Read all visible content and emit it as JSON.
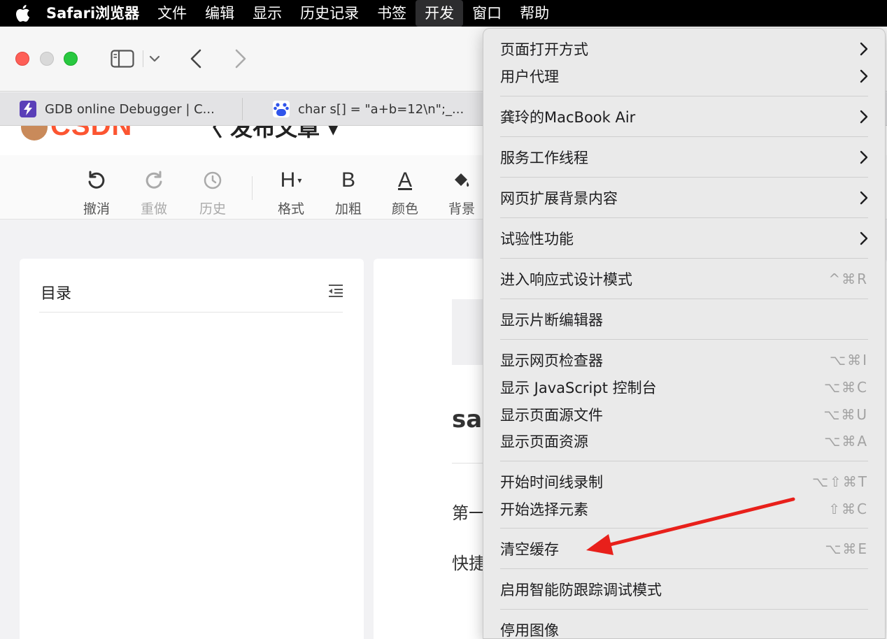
{
  "menubar": {
    "app": "Safari浏览器",
    "items": [
      "文件",
      "编辑",
      "显示",
      "历史记录",
      "书签",
      "开发",
      "窗口",
      "帮助"
    ],
    "active": "开发"
  },
  "tabs": [
    {
      "title": "GDB online Debugger | C..."
    },
    {
      "title": "char s[] = \"a+b=12\\n\";_..."
    }
  ],
  "page": {
    "logo_text": "CSDN",
    "publish_title": "〈 发布文章 ▾",
    "editor_tools": [
      {
        "icon": "undo-icon",
        "label": "撤消"
      },
      {
        "icon": "redo-icon",
        "label": "重做"
      },
      {
        "icon": "history-icon",
        "label": "历史"
      },
      {
        "icon": "heading-icon",
        "glyph": "H",
        "label": "格式"
      },
      {
        "icon": "bold-icon",
        "glyph": "B",
        "label": "加粗"
      },
      {
        "icon": "font-color-icon",
        "glyph": "A",
        "label": "颜色"
      },
      {
        "icon": "paint-bucket-icon",
        "label": "背景"
      }
    ],
    "toc_title": "目录",
    "fragments": [
      "sa",
      "第一",
      "快捷"
    ]
  },
  "dev_menu": {
    "items": [
      {
        "label": "页面打开方式",
        "submenu": true
      },
      {
        "label": "用户代理",
        "submenu": true
      },
      {
        "label": "龚玲的MacBook Air",
        "submenu": true
      },
      {
        "label": "服务工作线程",
        "submenu": true
      },
      {
        "label": "网页扩展背景内容",
        "submenu": true
      },
      {
        "label": "试验性功能",
        "submenu": true
      },
      {
        "label": "进入响应式设计模式",
        "shortcut": "^⌘R"
      },
      {
        "label": "显示片断编辑器"
      },
      {
        "label": "显示网页检查器",
        "shortcut": "⌥⌘I"
      },
      {
        "label": "显示 JavaScript 控制台",
        "shortcut": "⌥⌘C"
      },
      {
        "label": "显示页面源文件",
        "shortcut": "⌥⌘U"
      },
      {
        "label": "显示页面资源",
        "shortcut": "⌥⌘A"
      },
      {
        "label": "开始时间线录制",
        "shortcut": "⌥⇧⌘T"
      },
      {
        "label": "开始选择元素",
        "shortcut": "⇧⌘C"
      },
      {
        "label": "清空缓存",
        "shortcut": "⌥⌘E"
      },
      {
        "label": "启用智能防跟踪调试模式"
      },
      {
        "label": "停用图像"
      }
    ]
  },
  "colors": {
    "annotation_arrow": "#e8201b",
    "csdn_brand": "#fc5531"
  }
}
